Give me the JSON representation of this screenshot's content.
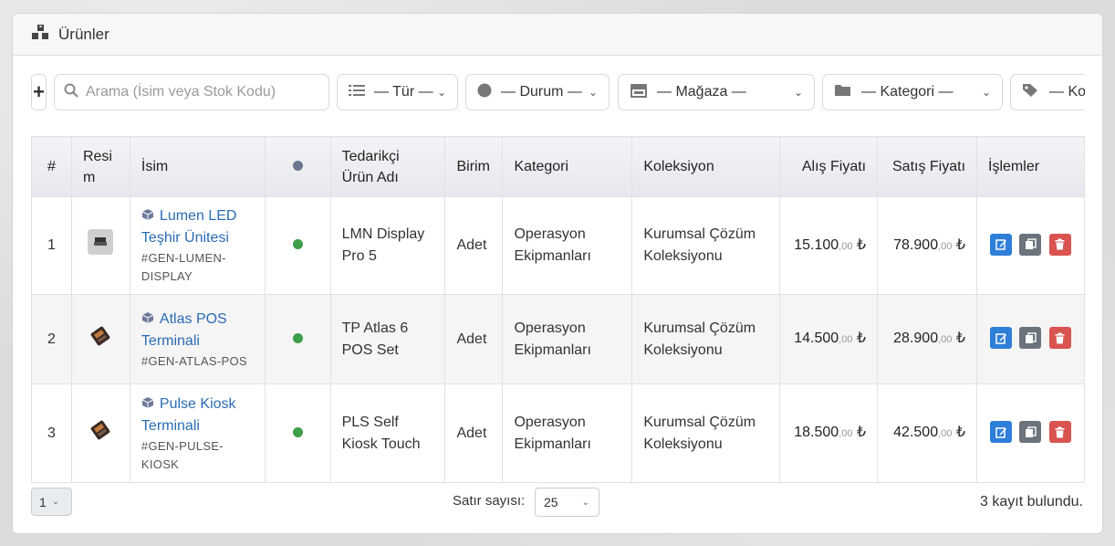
{
  "header": {
    "title": "Ürünler",
    "icon": "boxes-icon"
  },
  "toolbar": {
    "add_label": "+",
    "search_placeholder": "Arama (İsim veya Stok Kodu)",
    "filters": [
      {
        "label": "— Tür —",
        "icon": "list-icon"
      },
      {
        "label": "— Durum —",
        "icon": "circle-icon"
      },
      {
        "label": "— Mağaza —",
        "icon": "store-icon"
      },
      {
        "label": "— Kategori —",
        "icon": "folder-icon"
      },
      {
        "label": "— Kol",
        "icon": "tags-icon"
      }
    ]
  },
  "table": {
    "headers": {
      "num": "#",
      "image_1": "Resi",
      "image_2": "m",
      "name": "İsim",
      "supplier_1": "Tedarikçi",
      "supplier_2": "Ürün Adı",
      "unit": "Birim",
      "category": "Kategori",
      "collection": "Koleksiyon",
      "buy": "Alış Fiyatı",
      "sell": "Satış Fiyatı",
      "actions": "İşlemler"
    },
    "rows": [
      {
        "num": "1",
        "name_1": "Lumen LED",
        "name_2": "Teşhir Ünitesi",
        "sku_1": "#GEN-LUMEN-",
        "sku_2": "DISPLAY",
        "supplier_1": "LMN Display",
        "supplier_2": "Pro 5",
        "unit": "Adet",
        "category_1": "Operasyon",
        "category_2": "Ekipmanları",
        "collection_1": "Kurumsal Çözüm",
        "collection_2": "Koleksiyonu",
        "buy_main": "15.100",
        "buy_dec": ",00",
        "sell_main": "78.900",
        "sell_dec": ",00",
        "currency": "₺"
      },
      {
        "num": "2",
        "name_1": "Atlas POS",
        "name_2": "Terminali",
        "sku_1": "#GEN-ATLAS-POS",
        "sku_2": "",
        "supplier_1": "TP Atlas 6",
        "supplier_2": "POS Set",
        "unit": "Adet",
        "category_1": "Operasyon",
        "category_2": "Ekipmanları",
        "collection_1": "Kurumsal Çözüm",
        "collection_2": "Koleksiyonu",
        "buy_main": "14.500",
        "buy_dec": ",00",
        "sell_main": "28.900",
        "sell_dec": ",00",
        "currency": "₺"
      },
      {
        "num": "3",
        "name_1": "Pulse Kiosk",
        "name_2": "Terminali",
        "sku_1": "#GEN-PULSE-",
        "sku_2": "KIOSK",
        "supplier_1": "PLS Self",
        "supplier_2": "Kiosk Touch",
        "unit": "Adet",
        "category_1": "Operasyon",
        "category_2": "Ekipmanları",
        "collection_1": "Kurumsal Çözüm",
        "collection_2": "Koleksiyonu",
        "buy_main": "18.500",
        "buy_dec": ",00",
        "sell_main": "42.500",
        "sell_dec": ",00",
        "currency": "₺"
      }
    ]
  },
  "footer": {
    "page": "1",
    "rows_label": "Satır sayısı:",
    "rows_value": "25",
    "count_text": "3 kayıt bulundu."
  },
  "colors": {
    "status_active": "#3e9e4a",
    "link": "#2a6cb5",
    "edit": "#2f7fd8",
    "copy": "#6b737d",
    "delete": "#d9534f"
  }
}
